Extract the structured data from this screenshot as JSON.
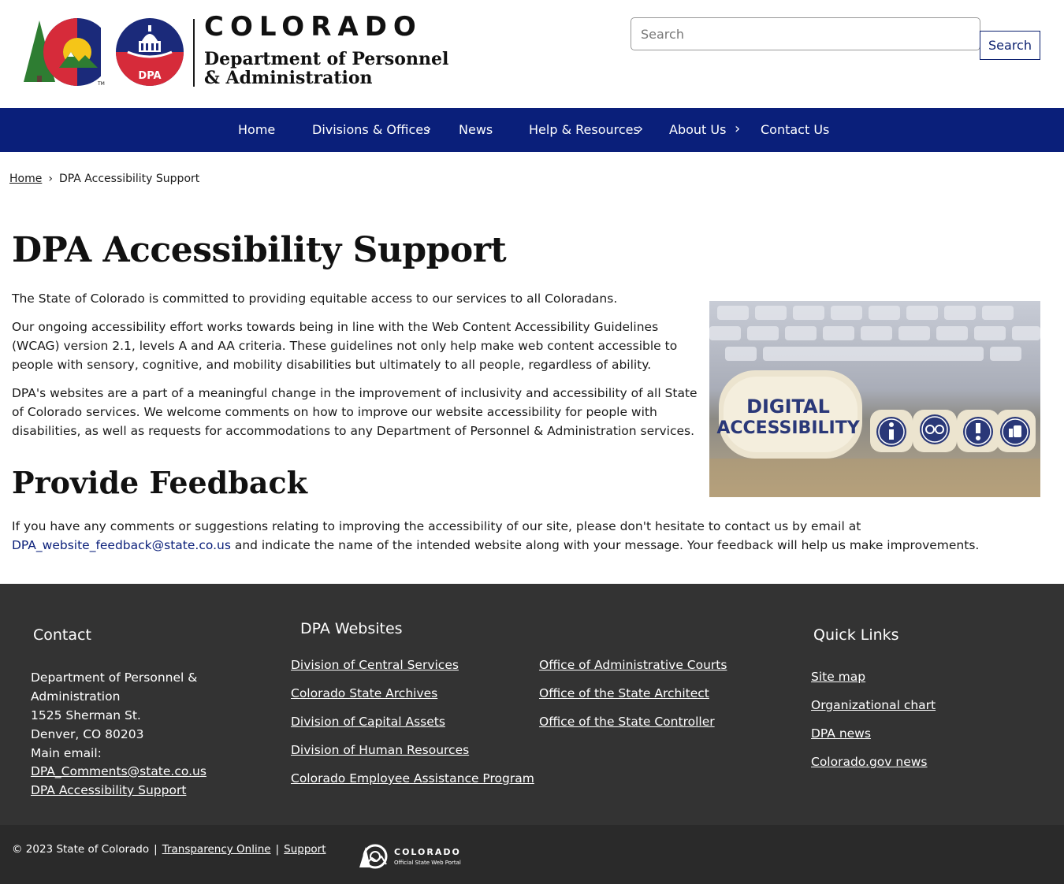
{
  "header": {
    "state_name": "COLORADO",
    "dept_line1": "Department of Personnel",
    "dept_line2": "& Administration",
    "dpa_badge": "DPA",
    "search_placeholder": "Search",
    "search_button": "Search"
  },
  "nav": {
    "items": [
      {
        "label": "Home"
      },
      {
        "label": "Divisions & Offices"
      },
      {
        "label": "News"
      },
      {
        "label": "Help & Resources"
      },
      {
        "label": "About Us"
      },
      {
        "label": "Contact Us"
      }
    ],
    "chevron": "›"
  },
  "breadcrumb": {
    "home": "Home",
    "separator": "›",
    "current": "DPA Accessibility Support"
  },
  "main": {
    "title": "DPA Accessibility Support",
    "paragraphs": [
      "The State of Colorado is committed to providing equitable access to our services to all Coloradans.",
      "Our ongoing accessibility effort works towards being in line with the Web Content Accessibility Guidelines (WCAG) version 2.1, levels A and AA criteria. These guidelines not only help make web content accessible to people with sensory, cognitive, and mobility disabilities but ultimately to all people, regardless of ability.",
      "DPA's websites are a part of a meaningful change in the improvement of inclusivity and accessibility of all State of Colorado services. We welcome comments on how to improve our website accessibility for people with disabilities, as well as requests for accommodations to any Department of Personnel & Administration services."
    ],
    "image_text_line1": "DIGITAL",
    "image_text_line2": "ACCESSIBILITY",
    "feedback_title": "Provide Feedback",
    "feedback_before": "If you have any comments or suggestions relating to improving the accessibility of our site, please don't hesitate to contact us by email at ",
    "feedback_email": "DPA_website_feedback@state.co.us",
    "feedback_after": " and indicate the name of the intended website along with your message. Your feedback will help us make improvements."
  },
  "footer": {
    "contact_title": "Contact",
    "contact_org_line1": "Department of Personnel &",
    "contact_org_line2": "Administration",
    "contact_street": "1525 Sherman St.",
    "contact_city": "Denver, CO 80203",
    "contact_email_label": "Main email:",
    "contact_email": "DPA_Comments@state.co.us",
    "contact_access": "DPA Accessibility Support",
    "websites_title": "DPA Websites",
    "websites_col1": [
      "Division of Central Services",
      "Colorado State Archives",
      "Division of Capital Assets",
      "Division of Human Resources",
      "Colorado Employee Assistance Program"
    ],
    "websites_col2": [
      "Office of Administrative Courts",
      "Office of the State Architect",
      "Office of the State Controller"
    ],
    "quick_title": "Quick Links",
    "quick_links": [
      "Site map",
      "Organizational chart",
      "DPA news",
      "Colorado.gov news"
    ]
  },
  "subfooter": {
    "copyright": "© 2023 State of Colorado",
    "separator": "|",
    "transparency": "Transparency Online",
    "support": "Support",
    "portal_name": "COLORADO",
    "portal_sub": "Official State Web Portal"
  }
}
